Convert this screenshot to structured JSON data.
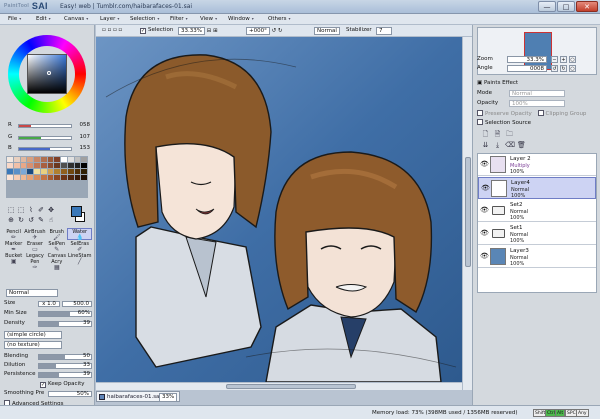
{
  "window": {
    "logo": "SAI",
    "logo_small": "PaintTool",
    "title": "Easy! web | Tumblr.com/haibarafaces-01.sai",
    "min": "—",
    "max": "□",
    "close": "✕"
  },
  "menu": [
    "File",
    "Edit",
    "Canvas",
    "Layer",
    "Selection",
    "Filter",
    "View",
    "Window",
    "Others"
  ],
  "rgb": [
    {
      "letter": "R",
      "value": "058",
      "color": "#c84848",
      "fraction": 0.23
    },
    {
      "letter": "G",
      "value": "107",
      "color": "#48a848",
      "fraction": 0.42
    },
    {
      "letter": "B",
      "value": "153",
      "color": "#4868c8",
      "fraction": 0.6
    }
  ],
  "swatches": [
    "#f2e8e0",
    "#e8d0c0",
    "#e0b8a0",
    "#d8a080",
    "#c88868",
    "#b07050",
    "#985838",
    "#804028",
    "#ffffff",
    "#e0e0e0",
    "#c0c0c0",
    "#a0a0a0",
    "#f8d8c8",
    "#f0c0a8",
    "#e8a888",
    "#d89070",
    "#c07858",
    "#a86040",
    "#8a4c30",
    "#6a3820",
    "#505050",
    "#303030",
    "#202020",
    "#000000",
    "#3a78b9",
    "#5a90c8",
    "#7aa8d8",
    "#1a4a80",
    "#f0e0a0",
    "#e8d080",
    "#d0a050",
    "#b08030",
    "#906020",
    "#704810",
    "#503008",
    "#302004",
    "#fce4d6",
    "#f6cdb4",
    "#eeb894",
    "#e4a276",
    "#d68c5c",
    "#c47444",
    "#a85c30",
    "#8a4622",
    "#6c3418",
    "#50260e",
    "#381a08",
    "#201004"
  ],
  "sel_tools": [
    "⬚",
    "⬚",
    "⌇",
    "✐",
    "✥",
    "⊕",
    "↻",
    "↺",
    "✎",
    "☝"
  ],
  "brushes": [
    {
      "label": "Pencil",
      "icon": "✏"
    },
    {
      "label": "AirBrush",
      "icon": "✈"
    },
    {
      "label": "Brush",
      "icon": "🖌"
    },
    {
      "label": "Water",
      "icon": "💧",
      "active": true
    },
    {
      "label": "Marker",
      "icon": "✒"
    },
    {
      "label": "Eraser",
      "icon": "▭"
    },
    {
      "label": "SelPen",
      "icon": "✎"
    },
    {
      "label": "SelEras",
      "icon": "✐"
    },
    {
      "label": "Bucket",
      "icon": "▣"
    },
    {
      "label": "Legacy Pen",
      "icon": "✑"
    },
    {
      "label": "Canvas Acry",
      "icon": "▦"
    },
    {
      "label": "LineStam",
      "icon": "╱"
    }
  ],
  "brush_mode": "Normal",
  "props": {
    "size_label": "Size",
    "size_mult": "x 1.0",
    "size_val": "500.0",
    "minsize_label": "Min Size",
    "minsize_val": "60%",
    "minsize_fraction": 0.6,
    "density_label": "Density",
    "density_val": "39",
    "density_fraction": 0.39,
    "shape": "(simple circle)",
    "texture": "(no texture)",
    "blending_label": "Blending",
    "blending_val": "50",
    "blending_fraction": 0.5,
    "dilution_label": "Dilution",
    "dilution_val": "33",
    "dilution_fraction": 0.33,
    "persistence_label": "Persistence",
    "persistence_val": "39",
    "persistence_fraction": 0.39,
    "keep_opacity": "Keep Opacity",
    "smoothing_label": "Smoothing Pre",
    "smoothing_val": "50%",
    "advanced": "Advanced Settings"
  },
  "toolbar": {
    "selection": "Selection",
    "zoom": "33.33%",
    "angle": "+000°",
    "mode": "Normal",
    "stabilizer_label": "Stabilizer",
    "stabilizer": "7"
  },
  "doc_tab": {
    "name": "haibarafaces-01.sai",
    "zoom": "33%"
  },
  "navigator": {
    "zoom_label": "Zoom",
    "zoom": "33.3%",
    "angle_label": "Angle",
    "angle": "0008"
  },
  "layer_props": {
    "paints_effect": "Paints Effect",
    "mode_label": "Mode",
    "mode": "Normal",
    "opacity_label": "Opacity",
    "opacity": "100%",
    "preserve": "Preserve Opacity",
    "clipping": "Clipping Group",
    "selection_source": "Selection Source"
  },
  "layers": [
    {
      "name": "Layer 2",
      "mode": "Multiply",
      "opacity": "100%",
      "type": "layer",
      "thumb": "#e8e0f0"
    },
    {
      "name": "Layer4",
      "mode": "Normal",
      "opacity": "100%",
      "type": "layer",
      "active": true,
      "thumb": "#ffffff"
    },
    {
      "name": "Set2",
      "mode": "Normal",
      "opacity": "100%",
      "type": "folder"
    },
    {
      "name": "Set1",
      "mode": "Normal",
      "opacity": "100%",
      "type": "folder"
    },
    {
      "name": "Layer3",
      "mode": "Normal",
      "opacity": "100%",
      "type": "layer",
      "thumb": "#5a86b6"
    }
  ],
  "status": {
    "memory": "Memory load: 73% (398MB used / 1356MB reserved)",
    "keys": [
      "Shift",
      "Ctrl",
      "Alt",
      "SPC",
      "Any"
    ]
  }
}
